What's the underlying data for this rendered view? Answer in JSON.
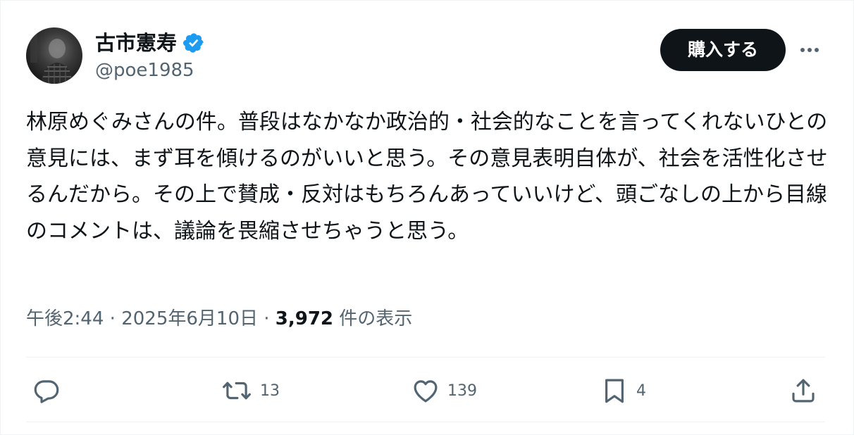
{
  "author": {
    "display_name": "古市憲寿",
    "handle": "@poe1985",
    "verified": true,
    "verified_color": "#1d9bf0",
    "avatar_icon": "profile-photo"
  },
  "header": {
    "buy_button_label": "購入する",
    "more_icon": "more-dots-icon"
  },
  "tweet": {
    "text": "林原めぐみさんの件。普段はなかなか政治的・社会的なことを言ってくれないひとの意見には、まず耳を傾けるのがいいと思う。その意見表明自体が、社会を活性化させるんだから。その上で賛成・反対はもちろんあっていいけど、頭ごなしの上から目線のコメントは、議論を畏縮させちゃうと思う。",
    "time": "午後2:44",
    "separator": "·",
    "date": "2025年6月10日",
    "views_count": "3,972",
    "views_label": "件の表示"
  },
  "actions": {
    "reply": {
      "icon": "reply-icon",
      "count": ""
    },
    "retweet": {
      "icon": "retweet-icon",
      "count": "13"
    },
    "like": {
      "icon": "heart-icon",
      "count": "139"
    },
    "bookmark": {
      "icon": "bookmark-icon",
      "count": "4"
    },
    "share": {
      "icon": "share-icon",
      "count": ""
    }
  },
  "colors": {
    "text_primary": "#0f1419",
    "text_secondary": "#536471",
    "divider": "#eff3f4",
    "button_bg": "#0f1419"
  }
}
